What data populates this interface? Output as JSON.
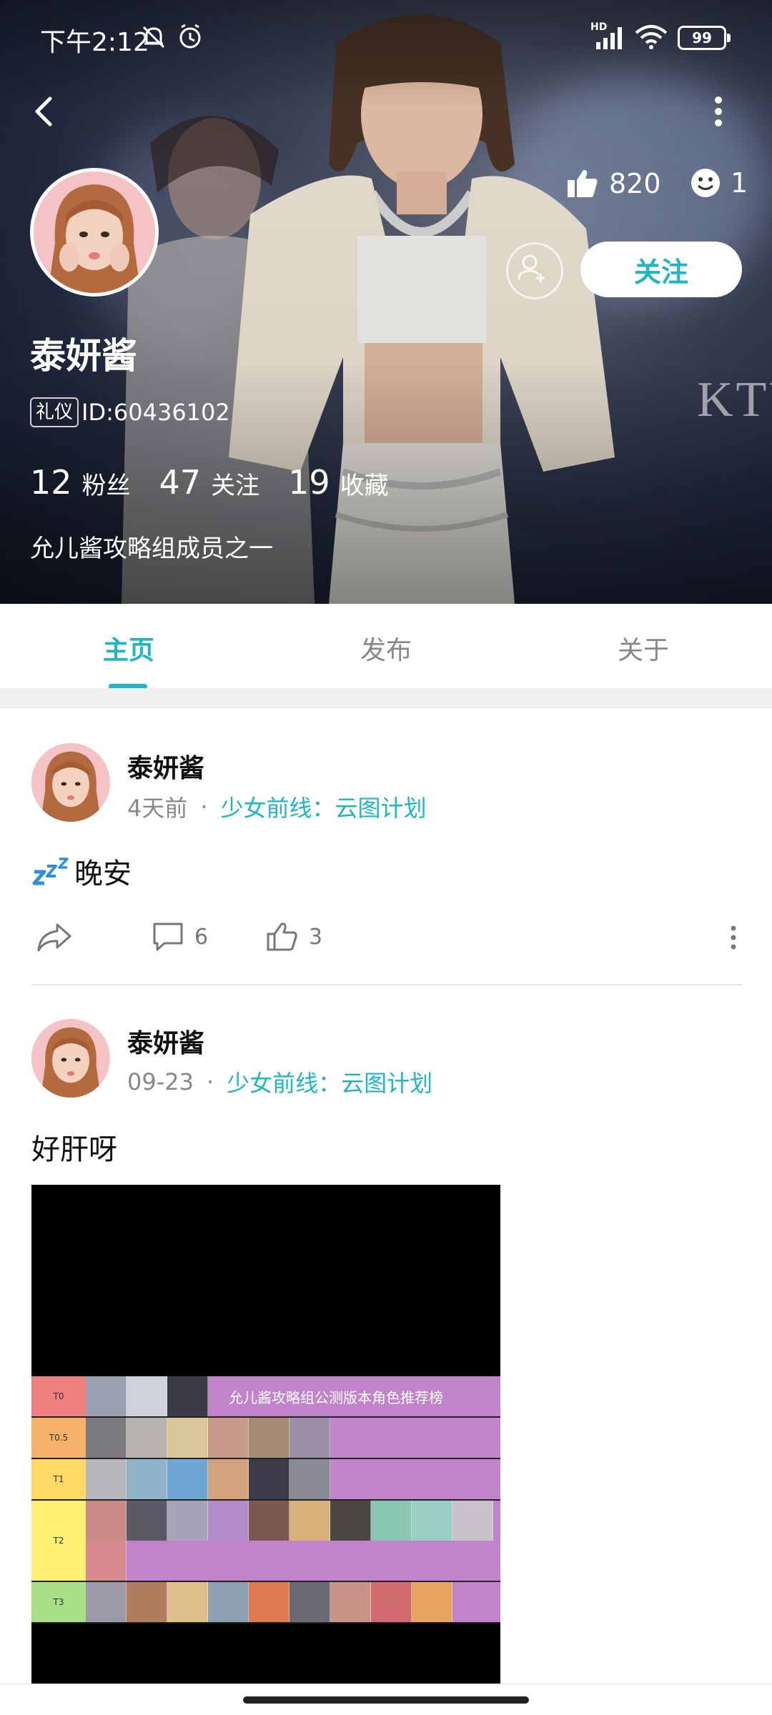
{
  "status": {
    "time": "下午2:12",
    "network": "HD",
    "battery": "99"
  },
  "header": {
    "watermark": "KTY",
    "like_count": "820",
    "smile_count": "1",
    "follow_label": "关注",
    "user_name": "泰妍酱",
    "role_badge": "礼仪",
    "user_id": "ID:60436102",
    "stats": [
      {
        "num": "12",
        "label": "粉丝"
      },
      {
        "num": "47",
        "label": "关注"
      },
      {
        "num": "19",
        "label": "收藏"
      }
    ],
    "bio": "允儿酱攻略组成员之一"
  },
  "tabs": [
    "主页",
    "发布",
    "关于"
  ],
  "posts": [
    {
      "author": "泰妍酱",
      "time": "4天前",
      "dot": "·",
      "game": "少女前线：云图计划",
      "text": "晚安",
      "comments": "6",
      "likes": "3"
    },
    {
      "author": "泰妍酱",
      "time": "09-23",
      "dot": "·",
      "game": "少女前线：云图计划",
      "text": "好肝呀",
      "image_title": "允儿酱攻略组公测版本角色推荐榜",
      "tiers": [
        "T0",
        "T0.5",
        "T1",
        "T2",
        "T3"
      ]
    }
  ],
  "colors": {
    "accent": "#1fb6c4",
    "tier_body": "#c183c9"
  }
}
